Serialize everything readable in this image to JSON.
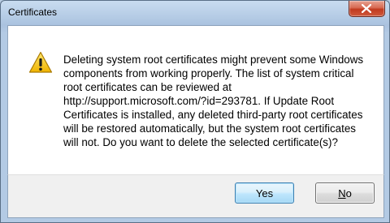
{
  "window": {
    "title": "Certificates"
  },
  "dialog": {
    "message": "Deleting system root certificates might prevent some Windows components from working properly. The list of system critical root certificates can be reviewed at http://support.microsoft.com/?id=293781. If Update Root Certificates is installed, any deleted third-party root certificates will be restored automatically, but the system root certificates will not. Do you want to delete the selected certificate(s)?",
    "icon": "warning-icon"
  },
  "buttons": {
    "yes_label": "Yes",
    "no_mnemonic": "N",
    "no_rest": "o"
  },
  "colors": {
    "accent": "#3c7fb1",
    "close": "#c13a1f",
    "warning": "#f5c400"
  }
}
